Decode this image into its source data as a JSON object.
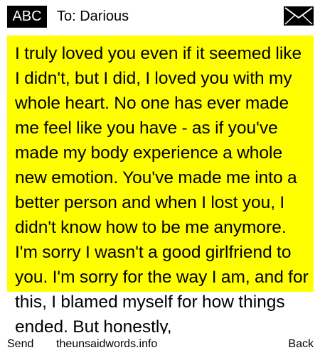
{
  "header": {
    "mode_label": "ABC",
    "recipient": "To: Darious",
    "icon": "envelope-icon"
  },
  "message": {
    "highlight_color": "#ffff00",
    "text": "I truly loved you even if it seemed like I didn't, but I did, I loved you with my whole heart. No one has ever made me feel like you have - as if you've made my body experience a whole new emotion. You've made me into a better person and when I lost you, I didn't know how to be me anymore. I'm sorry I wasn't a good girlfriend to you. I'm sorry for the way I am, and for this, I blamed myself for how things ended. But honestly,"
  },
  "footer": {
    "left_key": "Send",
    "center_text": "theunsaidwords.info",
    "right_key": "Back"
  }
}
